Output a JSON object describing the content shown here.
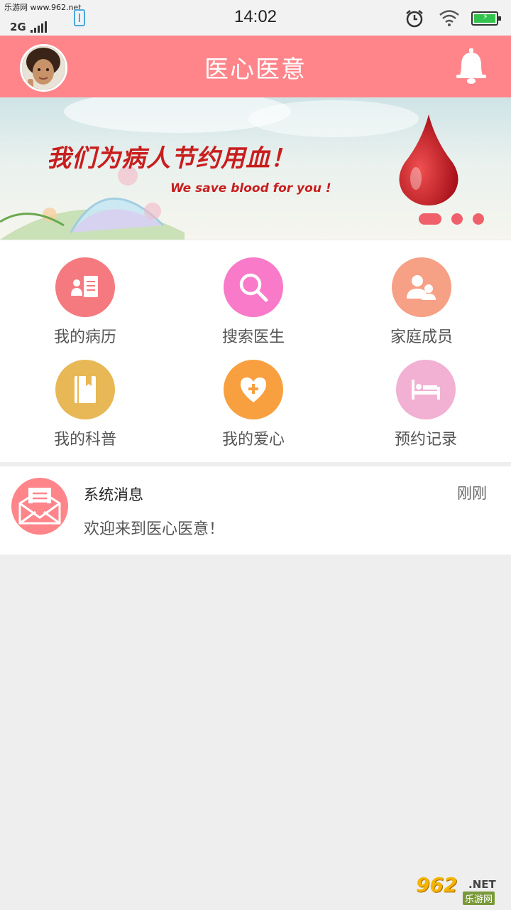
{
  "status_bar": {
    "watermark": "乐游网 www.962.net",
    "network": "2G",
    "time": "14:02"
  },
  "header": {
    "title": "医心医意"
  },
  "banner": {
    "headline": "我们为病人节约用血！",
    "tagline": "We save blood for you !",
    "pages": 3,
    "active_page": 1
  },
  "menu": [
    {
      "label": "我的病历",
      "icon": "medical-record-icon",
      "color": "#f57a80"
    },
    {
      "label": "搜索医生",
      "icon": "search-icon",
      "color": "#f87ac8"
    },
    {
      "label": "家庭成员",
      "icon": "family-members-icon",
      "color": "#f6a086"
    },
    {
      "label": "我的科普",
      "icon": "book-icon",
      "color": "#e8b856"
    },
    {
      "label": "我的爱心",
      "icon": "heart-plus-icon",
      "color": "#f8a040"
    },
    {
      "label": "预约记录",
      "icon": "bed-icon",
      "color": "#f2b0d2"
    }
  ],
  "message": {
    "title": "系统消息",
    "time": "刚刚",
    "body": "欢迎来到医心医意！"
  },
  "watermark": {
    "number": "962",
    "domain": ".NET",
    "site": "乐游网"
  },
  "colors": {
    "header": "#ff858a",
    "accent": "#f0606a"
  }
}
